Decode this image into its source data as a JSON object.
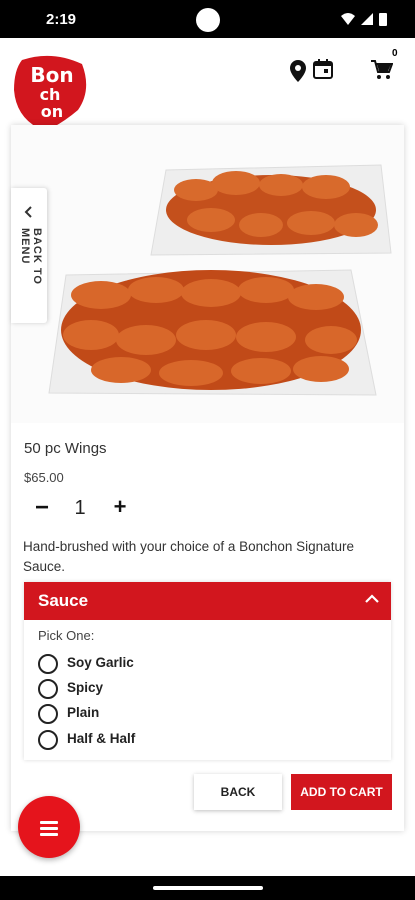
{
  "status_bar": {
    "time": "2:19"
  },
  "header": {
    "logo_text": "Bonchon",
    "cart_count": "0",
    "icons": [
      "location-pin-icon",
      "calendar-icon",
      "cart-icon"
    ]
  },
  "back_tab": {
    "label": "BACK TO MENU"
  },
  "product": {
    "name": "50 pc Wings",
    "price": "$65.00",
    "quantity": "1",
    "description": "Hand-brushed with your choice of a Bonchon Signature Sauce."
  },
  "sauce": {
    "heading": "Sauce",
    "pick_label": "Pick One:",
    "options": [
      "Soy Garlic",
      "Spicy",
      "Plain",
      "Half & Half"
    ]
  },
  "actions": {
    "back_label": "BACK",
    "add_label": "ADD TO CART"
  },
  "colors": {
    "brand_red": "#d2161e"
  }
}
